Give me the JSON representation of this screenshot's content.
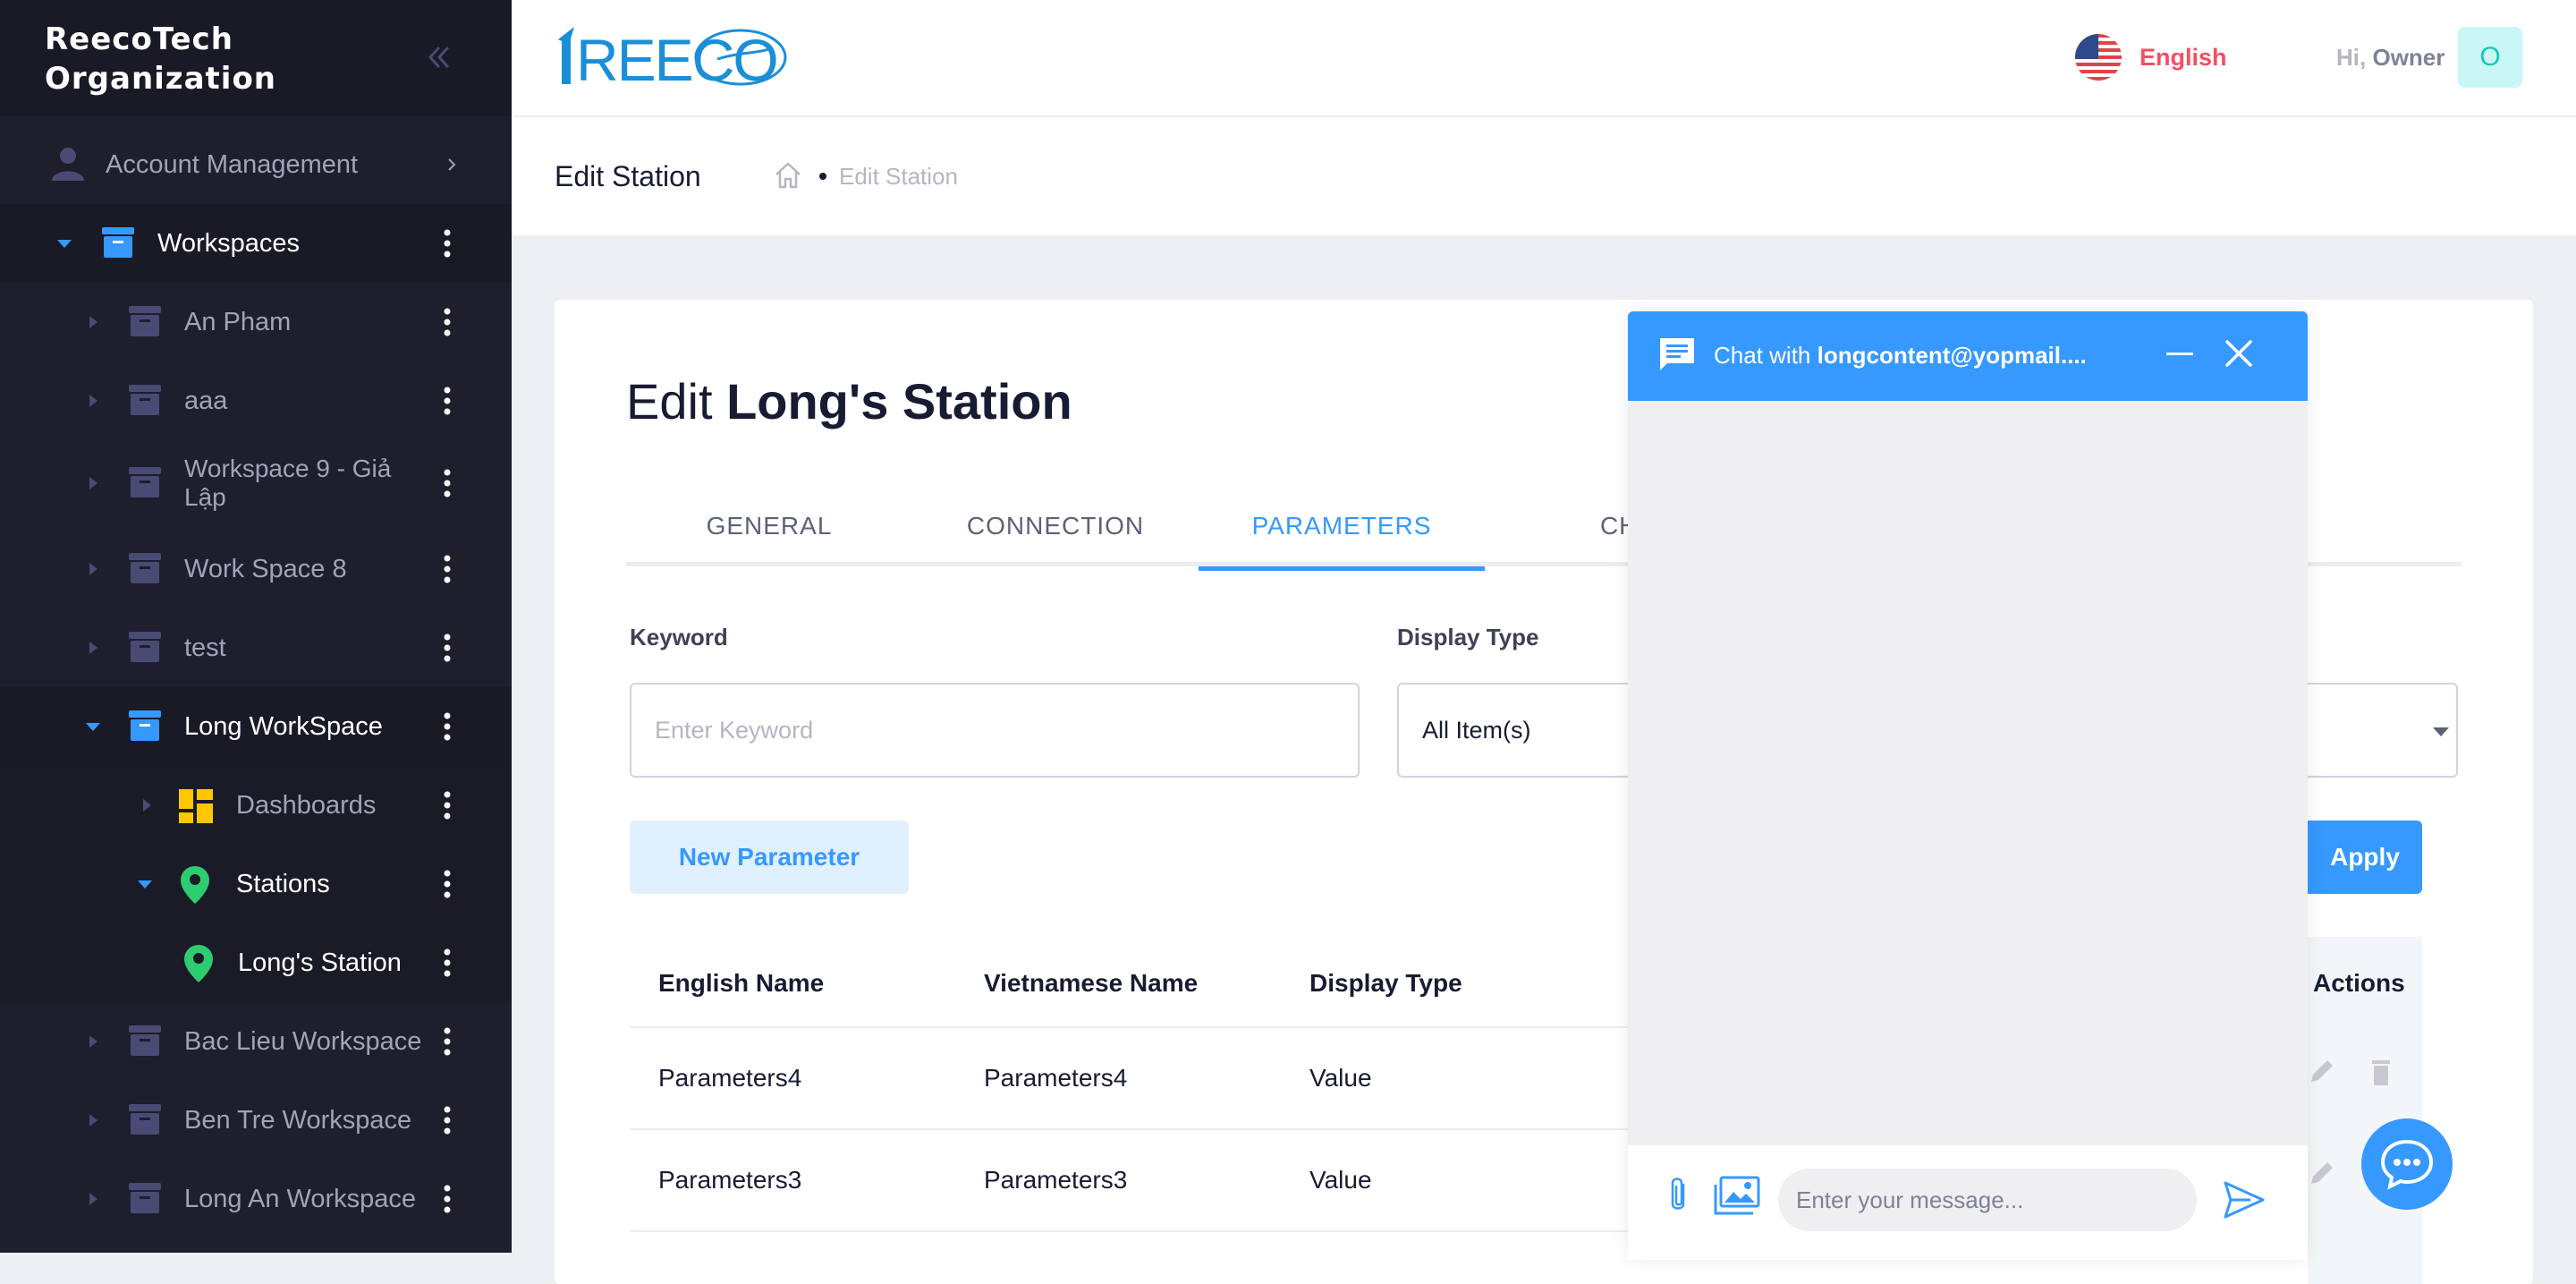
{
  "sidebar": {
    "org_name_line1": "ReecoTech",
    "org_name_line2": "Organization",
    "items": [
      {
        "label": "Account Management"
      },
      {
        "label": "Workspaces"
      },
      {
        "label": "An Pham"
      },
      {
        "label": "aaa"
      },
      {
        "label": "Workspace 9 - Giả",
        "label2": "Lập"
      },
      {
        "label": "Work Space 8"
      },
      {
        "label": "test"
      },
      {
        "label": "Long WorkSpace"
      },
      {
        "label": "Dashboards"
      },
      {
        "label": "Stations"
      },
      {
        "label": "Long's Station"
      },
      {
        "label": "Bac Lieu Workspace"
      },
      {
        "label": "Ben Tre Workspace"
      },
      {
        "label": "Long An Workspace"
      }
    ]
  },
  "header": {
    "logo_text": "REECO",
    "language": "English",
    "greeting": "Hi,",
    "user_name": "Owner",
    "avatar_letter": "O"
  },
  "subheader": {
    "title": "Edit Station",
    "breadcrumb": "Edit Station"
  },
  "page": {
    "title_prefix": "Edit",
    "title_name": "Long's Station",
    "tabs": [
      "GENERAL",
      "CONNECTION",
      "PARAMETERS",
      "CHA"
    ],
    "active_tab": "PARAMETERS",
    "keyword_label": "Keyword",
    "keyword_placeholder": "Enter Keyword",
    "display_type_label": "Display Type",
    "display_type_value": "All Item(s)",
    "new_parameter_button": "New Parameter",
    "apply_button": "Apply",
    "table": {
      "headers": [
        "English Name",
        "Vietnamese Name",
        "Display Type",
        "Actions"
      ],
      "rows": [
        [
          "Parameters4",
          "Parameters4",
          "Value"
        ],
        [
          "Parameters3",
          "Parameters3",
          "Value"
        ]
      ]
    }
  },
  "chat": {
    "title_prefix": "Chat with",
    "title_user": "longcontent@yopmail....",
    "input_placeholder": "Enter your message..."
  },
  "colors": {
    "primary": "#3699ff",
    "sidebar_bg": "#1e1e2d",
    "danger": "#f64e60",
    "station_pin": "#2ecc71",
    "dashboard_icon": "#ffc700"
  }
}
